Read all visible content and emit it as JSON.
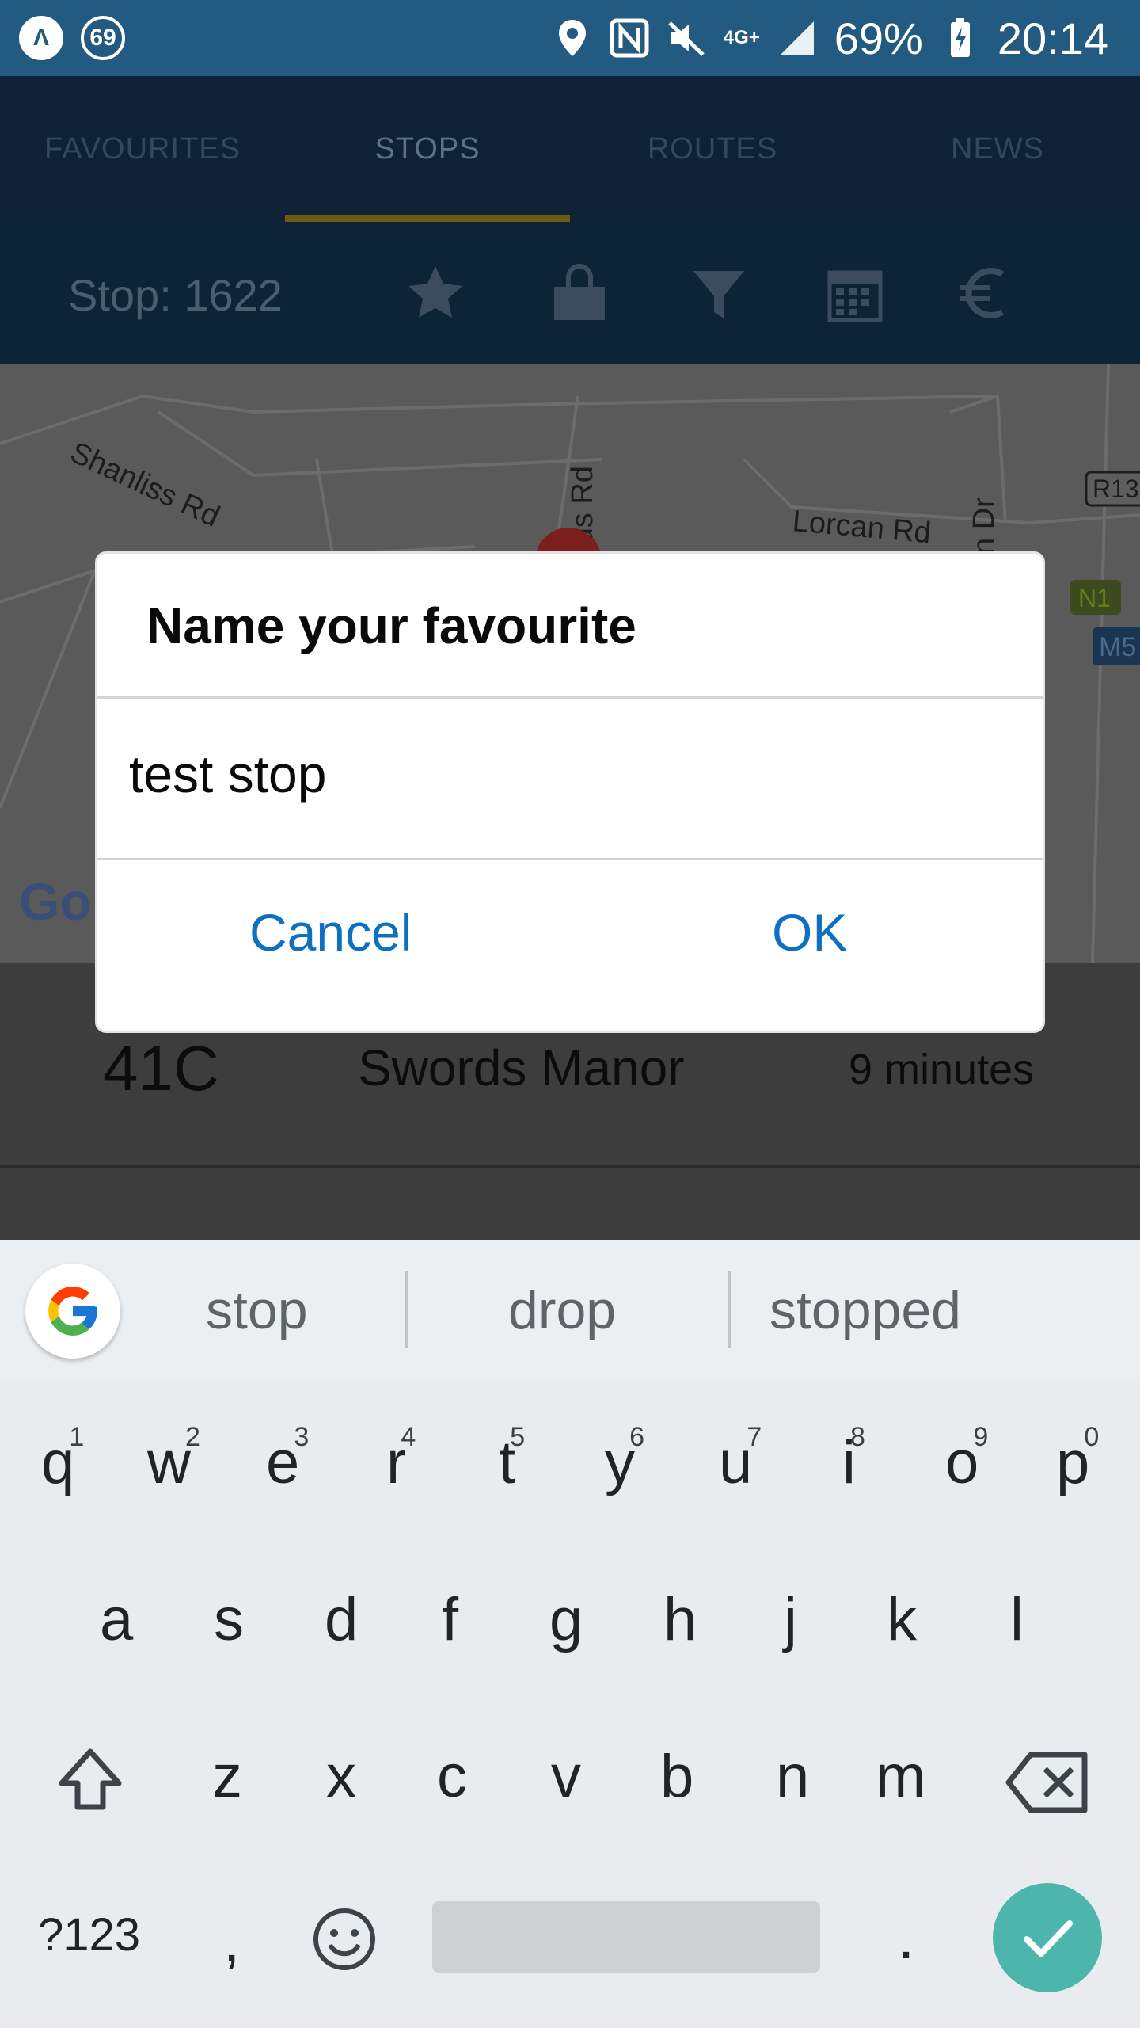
{
  "status_bar": {
    "app_badge": "69",
    "network": "4G+",
    "battery": "69%",
    "time": "20:14"
  },
  "tabs": [
    "FAVOURITES",
    "STOPS",
    "ROUTES",
    "NEWS"
  ],
  "active_tab": "STOPS",
  "toolbar": {
    "stop_label": "Stop: 1622",
    "icons": [
      "star-icon",
      "shopping-bag-icon",
      "filter-icon",
      "calendar-icon",
      "euro-icon"
    ]
  },
  "map": {
    "labels": [
      "Shanliss Rd",
      "rds Rd",
      "Lorcan Rd",
      "n Dr",
      "R13",
      "N1",
      "M5"
    ],
    "google_logo": "Go"
  },
  "departure_row": {
    "route": "41C",
    "destination": "Swords Manor",
    "time": "9 minutes"
  },
  "dialog": {
    "title": "Name your favourite",
    "input_value": "test stop",
    "cancel_label": "Cancel",
    "ok_label": "OK"
  },
  "keyboard": {
    "suggestions": [
      "stop",
      "drop",
      "stopped"
    ],
    "row1": [
      "q",
      "w",
      "e",
      "r",
      "t",
      "y",
      "u",
      "i",
      "o",
      "p"
    ],
    "row1_numbers": [
      "1",
      "2",
      "3",
      "4",
      "5",
      "6",
      "7",
      "8",
      "9",
      "0"
    ],
    "row2": [
      "a",
      "s",
      "d",
      "f",
      "g",
      "h",
      "j",
      "k",
      "l"
    ],
    "row3": [
      "z",
      "x",
      "c",
      "v",
      "b",
      "n",
      "m"
    ],
    "symbols_label": "?123",
    "comma": ",",
    "period": ".",
    "accent_color": "#4db6ac"
  }
}
